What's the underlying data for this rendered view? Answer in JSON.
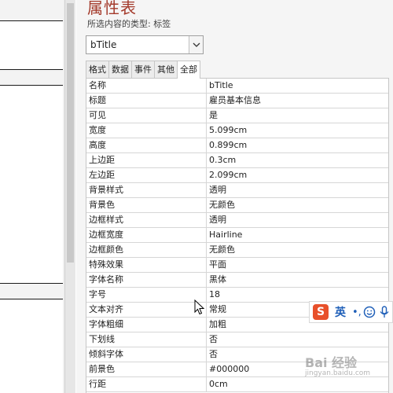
{
  "sheet": {
    "title": "属性表",
    "selection_type": "所选内容的类型: 标签",
    "combo_value": "bTitle"
  },
  "tabs": [
    "格式",
    "数据",
    "事件",
    "其他",
    "全部"
  ],
  "active_tab": "全部",
  "properties": [
    {
      "name": "名称",
      "value": "bTitle"
    },
    {
      "name": "标题",
      "value": "雇员基本信息"
    },
    {
      "name": "可见",
      "value": "是"
    },
    {
      "name": "宽度",
      "value": "5.099cm"
    },
    {
      "name": "高度",
      "value": "0.899cm"
    },
    {
      "name": "上边距",
      "value": "0.3cm"
    },
    {
      "name": "左边距",
      "value": "2.099cm"
    },
    {
      "name": "背景样式",
      "value": "透明"
    },
    {
      "name": "背景色",
      "value": "无颜色"
    },
    {
      "name": "边框样式",
      "value": "透明"
    },
    {
      "name": "边框宽度",
      "value": "Hairline"
    },
    {
      "name": "边框颜色",
      "value": "无颜色"
    },
    {
      "name": "特殊效果",
      "value": "平面"
    },
    {
      "name": "字体名称",
      "value": "黑体"
    },
    {
      "name": "字号",
      "value": "18"
    },
    {
      "name": "文本对齐",
      "value": "常规"
    },
    {
      "name": "字体粗细",
      "value": "加粗"
    },
    {
      "name": "下划线",
      "value": "否"
    },
    {
      "name": "倾斜字体",
      "value": "否"
    },
    {
      "name": "前景色",
      "value": "#000000"
    },
    {
      "name": "行距",
      "value": "0cm"
    }
  ],
  "ime": {
    "logo": "S",
    "lang": "英",
    "punct": "•,"
  },
  "watermark": {
    "main": "Bai 经验",
    "sub": "jingyan.baidu.com"
  },
  "colors": {
    "title": "#a43b2c",
    "ime_logo": "#e8502a",
    "ime_text": "#1f5fb8"
  }
}
